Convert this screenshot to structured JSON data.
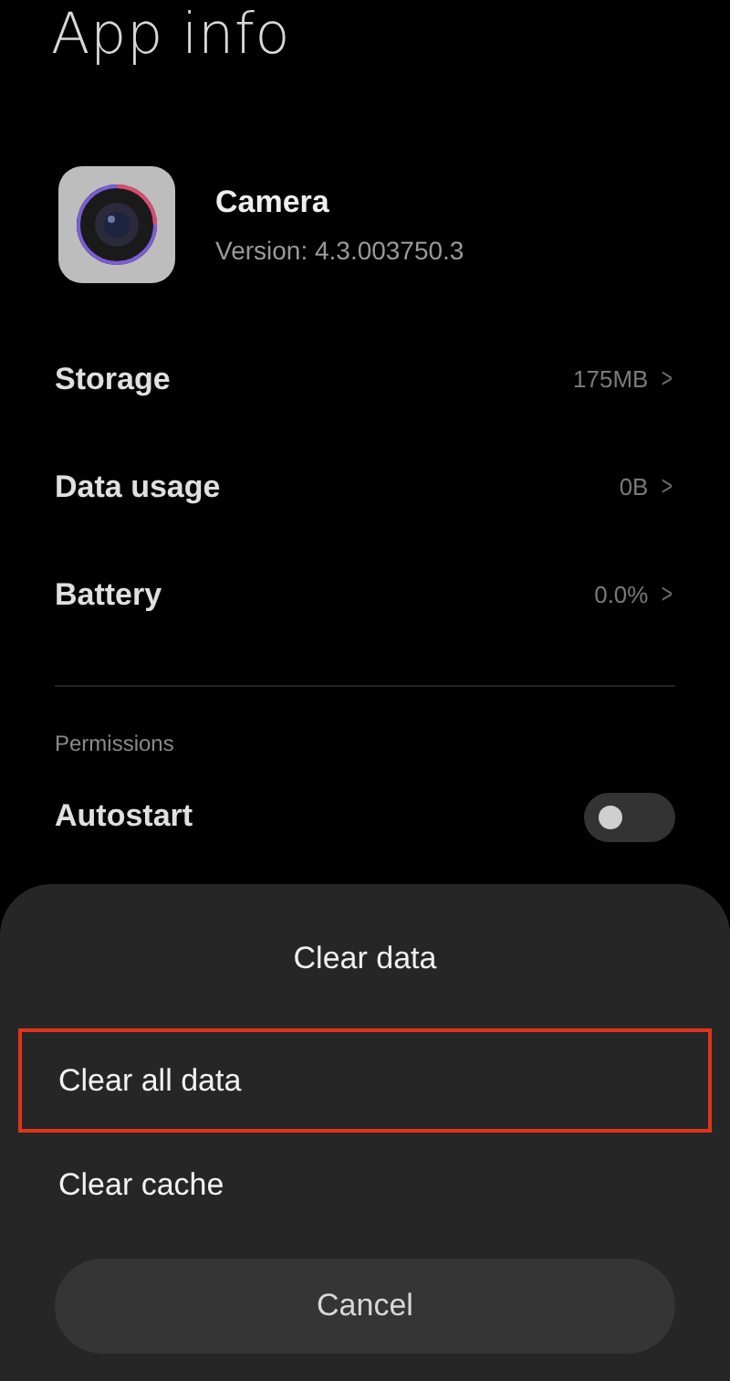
{
  "header": {
    "title": "App info"
  },
  "app": {
    "name": "Camera",
    "version": "Version: 4.3.003750.3"
  },
  "info_rows": [
    {
      "label": "Storage",
      "value": "175MB",
      "chevron": ">"
    },
    {
      "label": "Data usage",
      "value": "0B",
      "chevron": ">"
    },
    {
      "label": "Battery",
      "value": "0.0%",
      "chevron": ">"
    }
  ],
  "permissions": {
    "heading": "Permissions",
    "items": [
      {
        "label": "Autostart",
        "on": false
      }
    ]
  },
  "dialog": {
    "title": "Clear data",
    "options": [
      {
        "label": "Clear all data",
        "highlighted": true
      },
      {
        "label": "Clear cache",
        "highlighted": false
      }
    ],
    "cancel": "Cancel"
  }
}
